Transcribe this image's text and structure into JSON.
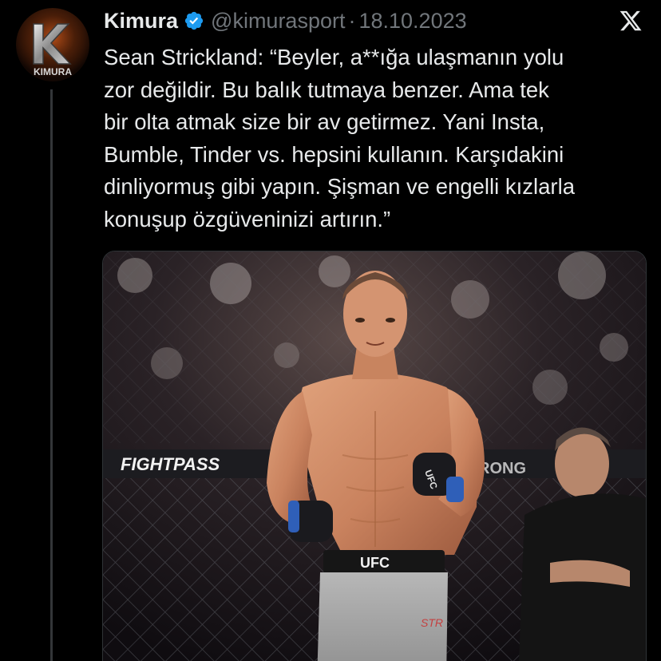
{
  "account": {
    "display_name": "Kimura",
    "handle": "@kimurasport",
    "separator": "·",
    "date": "18.10.2023",
    "avatar_text": "KIMURA"
  },
  "tweet": {
    "lines": [
      "Sean Strickland: “Beyler, a**ığa ulaşmanın yolu",
      "zor değildir. Bu balık tutmaya benzer. Ama tek",
      "bir olta atmak size bir av getirmez. Yani Insta,",
      "Bumble, Tinder vs. hepsini kullanın. Karşıdakini",
      "dinliyormuş gibi yapın. Şişman ve engelli kızlarla",
      "konuşup özgüveninizi artırın.”"
    ]
  },
  "media": {
    "banner_text": "FIGHTPASS",
    "glove_text": "UFC",
    "shorts_text": "UFC",
    "side_text": "STR",
    "banner_right_text": "RONG"
  },
  "icons": {
    "verified": "verified-badge-icon",
    "platform": "x-logo-icon"
  },
  "colors": {
    "background": "#000000",
    "text": "#e7e9ea",
    "muted": "#71767b",
    "verified": "#1d9bf0"
  }
}
